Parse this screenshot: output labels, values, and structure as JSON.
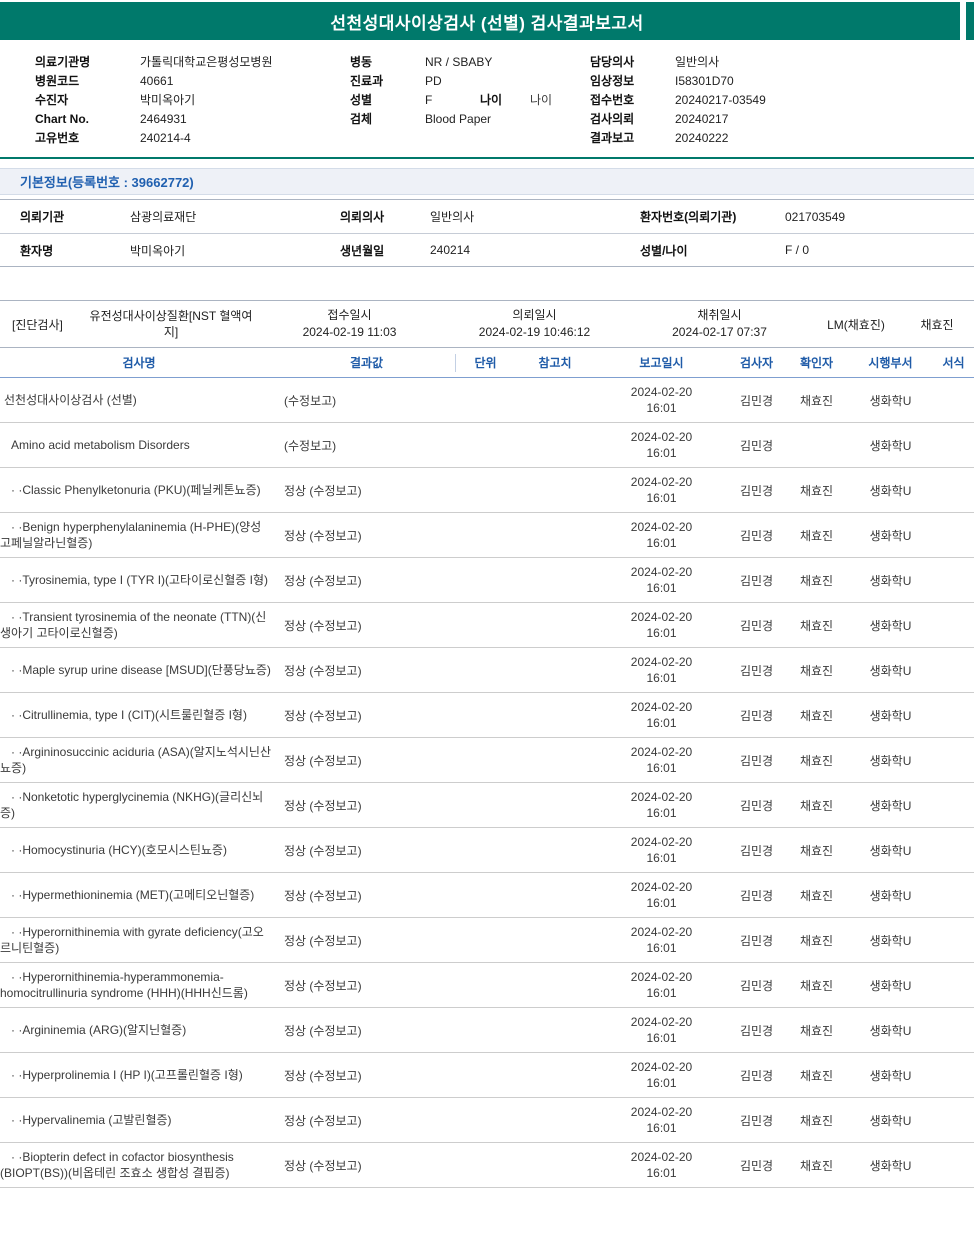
{
  "colors": {
    "accent_teal": "#00796B",
    "header_blue": "#1F5BA8"
  },
  "report": {
    "title": "선천성대사이상검사 (선별) 검사결과보고서"
  },
  "header": {
    "col1": [
      {
        "label": "의료기관명",
        "value": "가톨릭대학교은평성모병원"
      },
      {
        "label": "병원코드",
        "value": "40661"
      },
      {
        "label": "수진자",
        "value": "박미옥아기"
      },
      {
        "label": "Chart No.",
        "value": "2464931"
      },
      {
        "label": "고유번호",
        "value": "240214-4"
      }
    ],
    "col2": [
      {
        "label": "병동",
        "value": "NR / SBABY"
      },
      {
        "label": "진료과",
        "value": "PD"
      },
      {
        "label": "성별",
        "value": "F",
        "label2": "나이",
        "value2": "나이"
      },
      {
        "label": "검체",
        "value": "Blood Paper"
      }
    ],
    "col3": [
      {
        "label": "담당의사",
        "value": "일반의사"
      },
      {
        "label": "임상정보",
        "value": "I58301D70"
      },
      {
        "label": "접수번호",
        "value": "20240217-03549"
      },
      {
        "label": "검사의뢰",
        "value": "20240217"
      },
      {
        "label": "결과보고",
        "value": "20240222"
      }
    ]
  },
  "basic_info": {
    "section_title": "기본정보(등록번호 : 39662772)",
    "rows": [
      [
        {
          "label": "의뢰기관",
          "value": "삼광의료재단"
        },
        {
          "label": "의뢰의사",
          "value": "일반의사"
        },
        {
          "label": "환자번호(의뢰기관)",
          "value": "021703549"
        }
      ],
      [
        {
          "label": "환자명",
          "value": "박미옥아기"
        },
        {
          "label": "생년월일",
          "value": "240214"
        },
        {
          "label": "성별/나이",
          "value": "F / 0"
        }
      ]
    ]
  },
  "order": {
    "category": "[진단검사]",
    "test_group": "유전성대사이상질환[NST 혈액여지]",
    "receipt": {
      "label": "접수일시",
      "value": "2024-02-19 11:03"
    },
    "request": {
      "label": "의뢰일시",
      "value": "2024-02-19 10:46:12"
    },
    "collection": {
      "label": "채취일시",
      "value": "2024-02-17 07:37"
    },
    "collector1": "LM(채효진)",
    "collector2": "채효진"
  },
  "results": {
    "columns": [
      "검사명",
      "결과값",
      "단위",
      "참고치",
      "보고일시",
      "검사자",
      "확인자",
      "시행부서",
      "서식"
    ],
    "rows": [
      {
        "level": 0,
        "name": "선천성대사이상검사 (선별)",
        "result": "(수정보고)",
        "unit": "",
        "reference": "",
        "report_date": "2024-02-20",
        "report_time": "16:01",
        "tester": "김민경",
        "confirmer": "채효진",
        "department": "생화학U",
        "format": ""
      },
      {
        "level": 1,
        "name": "Amino acid metabolism Disorders",
        "result": "(수정보고)",
        "unit": "",
        "reference": "",
        "report_date": "2024-02-20",
        "report_time": "16:01",
        "tester": "김민경",
        "confirmer": "",
        "department": "생화학U",
        "format": ""
      },
      {
        "level": 2,
        "name": "· ·Classic Phenylketonuria (PKU)(페닐케톤뇨증)",
        "result": "정상 (수정보고)",
        "unit": "",
        "reference": "",
        "report_date": "2024-02-20",
        "report_time": "16:01",
        "tester": "김민경",
        "confirmer": "채효진",
        "department": "생화학U",
        "format": ""
      },
      {
        "level": 2,
        "name": "· ·Benign hyperphenylalaninemia (H-PHE)(양성 고페닐알라닌혈증)",
        "result": "정상 (수정보고)",
        "unit": "",
        "reference": "",
        "report_date": "2024-02-20",
        "report_time": "16:01",
        "tester": "김민경",
        "confirmer": "채효진",
        "department": "생화학U",
        "format": ""
      },
      {
        "level": 2,
        "name": "· ·Tyrosinemia, type I (TYR I)(고타이로신혈증 I형)",
        "result": "정상 (수정보고)",
        "unit": "",
        "reference": "",
        "report_date": "2024-02-20",
        "report_time": "16:01",
        "tester": "김민경",
        "confirmer": "채효진",
        "department": "생화학U",
        "format": ""
      },
      {
        "level": 2,
        "name": "· ·Transient tyrosinemia of the neonate (TTN)(신생아기 고타이로신혈증)",
        "result": "정상 (수정보고)",
        "unit": "",
        "reference": "",
        "report_date": "2024-02-20",
        "report_time": "16:01",
        "tester": "김민경",
        "confirmer": "채효진",
        "department": "생화학U",
        "format": ""
      },
      {
        "level": 2,
        "name": "· ·Maple syrup urine disease [MSUD](단풍당뇨증)",
        "result": "정상 (수정보고)",
        "unit": "",
        "reference": "",
        "report_date": "2024-02-20",
        "report_time": "16:01",
        "tester": "김민경",
        "confirmer": "채효진",
        "department": "생화학U",
        "format": ""
      },
      {
        "level": 2,
        "name": "· ·Citrullinemia, type I (CIT)(시트룰린혈증 I형)",
        "result": "정상 (수정보고)",
        "unit": "",
        "reference": "",
        "report_date": "2024-02-20",
        "report_time": "16:01",
        "tester": "김민경",
        "confirmer": "채효진",
        "department": "생화학U",
        "format": ""
      },
      {
        "level": 2,
        "name": "· ·Argininosuccinic aciduria (ASA)(알지노석시닌산뇨증)",
        "result": "정상 (수정보고)",
        "unit": "",
        "reference": "",
        "report_date": "2024-02-20",
        "report_time": "16:01",
        "tester": "김민경",
        "confirmer": "채효진",
        "department": "생화학U",
        "format": ""
      },
      {
        "level": 2,
        "name": "· ·Nonketotic hyperglycinemia (NKHG)(글리신뇌증)",
        "result": "정상 (수정보고)",
        "unit": "",
        "reference": "",
        "report_date": "2024-02-20",
        "report_time": "16:01",
        "tester": "김민경",
        "confirmer": "채효진",
        "department": "생화학U",
        "format": ""
      },
      {
        "level": 2,
        "name": "· ·Homocystinuria (HCY)(호모시스틴뇨증)",
        "result": "정상 (수정보고)",
        "unit": "",
        "reference": "",
        "report_date": "2024-02-20",
        "report_time": "16:01",
        "tester": "김민경",
        "confirmer": "채효진",
        "department": "생화학U",
        "format": ""
      },
      {
        "level": 2,
        "name": "· ·Hypermethioninemia (MET)(고메티오닌혈증)",
        "result": "정상 (수정보고)",
        "unit": "",
        "reference": "",
        "report_date": "2024-02-20",
        "report_time": "16:01",
        "tester": "김민경",
        "confirmer": "채효진",
        "department": "생화학U",
        "format": ""
      },
      {
        "level": 2,
        "name": "· ·Hyperornithinemia with gyrate deficiency(고오르니틴혈증)",
        "result": "정상 (수정보고)",
        "unit": "",
        "reference": "",
        "report_date": "2024-02-20",
        "report_time": "16:01",
        "tester": "김민경",
        "confirmer": "채효진",
        "department": "생화학U",
        "format": ""
      },
      {
        "level": 2,
        "name": "· ·Hyperornithinemia-hyperammonemia-homocitrullinuria syndrome (HHH)(HHH신드롬)",
        "result": "정상 (수정보고)",
        "unit": "",
        "reference": "",
        "report_date": "2024-02-20",
        "report_time": "16:01",
        "tester": "김민경",
        "confirmer": "채효진",
        "department": "생화학U",
        "format": ""
      },
      {
        "level": 2,
        "name": "· ·Argininemia (ARG)(알지닌혈증)",
        "result": "정상 (수정보고)",
        "unit": "",
        "reference": "",
        "report_date": "2024-02-20",
        "report_time": "16:01",
        "tester": "김민경",
        "confirmer": "채효진",
        "department": "생화학U",
        "format": ""
      },
      {
        "level": 2,
        "name": "· ·Hyperprolinemia I (HP I)(고프롤린혈증 I형)",
        "result": "정상 (수정보고)",
        "unit": "",
        "reference": "",
        "report_date": "2024-02-20",
        "report_time": "16:01",
        "tester": "김민경",
        "confirmer": "채효진",
        "department": "생화학U",
        "format": ""
      },
      {
        "level": 2,
        "name": "· ·Hypervalinemia (고발린혈증)",
        "result": "정상 (수정보고)",
        "unit": "",
        "reference": "",
        "report_date": "2024-02-20",
        "report_time": "16:01",
        "tester": "김민경",
        "confirmer": "채효진",
        "department": "생화학U",
        "format": ""
      },
      {
        "level": 2,
        "name": "· ·Biopterin defect in cofactor biosynthesis (BIOPT(BS))(비옵테린 조효소 생합성 결핍증)",
        "result": "정상 (수정보고)",
        "unit": "",
        "reference": "",
        "report_date": "2024-02-20",
        "report_time": "16:01",
        "tester": "김민경",
        "confirmer": "채효진",
        "department": "생화학U",
        "format": ""
      }
    ]
  }
}
